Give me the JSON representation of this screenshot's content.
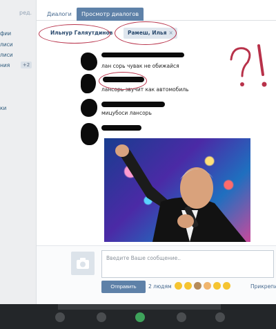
{
  "sidebar": {
    "edit_label": "ред.",
    "items": [
      "фии",
      "лиси",
      "лиси",
      "ния",
      "ки"
    ],
    "badge": "+2"
  },
  "tabs": [
    {
      "label": "Диалоги"
    },
    {
      "label": "Просмотр диалогов"
    }
  ],
  "participants": [
    {
      "name": "Ильнур Галяутдинов"
    },
    {
      "name": "Рамеш, Илья",
      "remove": "×"
    }
  ],
  "messages": [
    {
      "text": "лан сорь чувак не обижайся"
    },
    {
      "text": "лансорь звучит как автомобиль"
    },
    {
      "text": "мицубоси лансорь"
    },
    {
      "text": ""
    }
  ],
  "annotation": {
    "marks": "?!",
    "color": "#b8324a"
  },
  "composer": {
    "placeholder": "Введите Ваше сообщение..",
    "send_label": "Отправить",
    "recipients": "2 людям",
    "attach_label": "Прикрепи"
  },
  "colors": {
    "accent": "#5e81a8",
    "link": "#45688e",
    "annotation": "#b8324a"
  }
}
